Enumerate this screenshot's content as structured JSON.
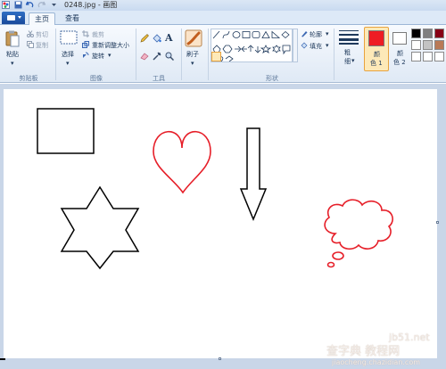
{
  "window": {
    "title": "0248.jpg - 画图"
  },
  "tabs": [
    {
      "label": "主页",
      "active": true
    },
    {
      "label": "查看",
      "active": false
    }
  ],
  "clipboard": {
    "paste": "粘贴",
    "cut": "剪切",
    "copy": "复制",
    "group": "剪贴板"
  },
  "image": {
    "select": "选择",
    "crop": "裁剪",
    "resize": "重新调整大小",
    "rotate": "旋转",
    "group": "图像"
  },
  "tools": {
    "group": "工具"
  },
  "brushes": {
    "label": "刷子"
  },
  "shapes": {
    "outline": "轮廓",
    "fill": "填充",
    "group": "形状"
  },
  "size": {
    "label": "粗",
    "label2": "细"
  },
  "colors": {
    "color1_label": "颜",
    "color1_label2": "色 1",
    "color2_label": "颜",
    "color2_label2": "色 2",
    "color1": "#ee1c24",
    "color2": "#ffffff",
    "palette_row1": [
      "#000000",
      "#7f7f7f",
      "#880015"
    ],
    "palette_row2": [
      "#ffffff",
      "#c3c3c3",
      "#b97a57"
    ],
    "palette_row3": [
      "#ffffff",
      "#ffffff",
      "#ffffff"
    ]
  },
  "watermark": {
    "line1": "查字典 教程网",
    "site": "jb51.net",
    "domain": "jiaocheng.chazidian.com"
  }
}
